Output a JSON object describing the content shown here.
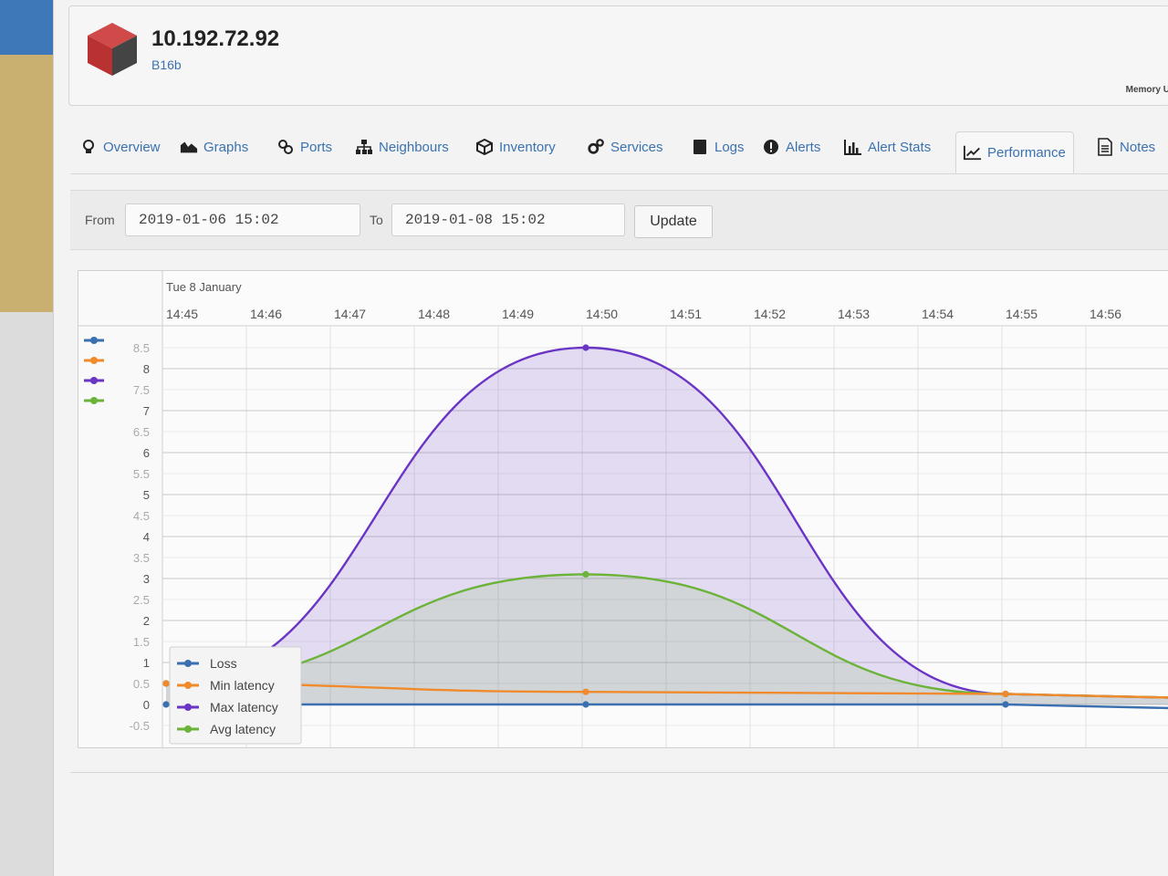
{
  "device": {
    "title": "10.192.72.92",
    "subtitle": "B16b",
    "memory_label": "Memory U"
  },
  "tabs": [
    {
      "label": "Overview",
      "icon": "lightbulb-icon"
    },
    {
      "label": "Graphs",
      "icon": "area-chart-icon"
    },
    {
      "label": "Ports",
      "icon": "link-icon"
    },
    {
      "label": "Neighbours",
      "icon": "sitemap-icon"
    },
    {
      "label": "Inventory",
      "icon": "cube-icon"
    },
    {
      "label": "Services",
      "icon": "cogs-icon"
    },
    {
      "label": "Logs",
      "icon": "book-icon"
    },
    {
      "label": "Alerts",
      "icon": "exclamation-circle-icon"
    },
    {
      "label": "Alert Stats",
      "icon": "bar-chart-icon"
    },
    {
      "label": "Performance",
      "icon": "line-chart-icon",
      "active": true
    },
    {
      "label": "Notes",
      "icon": "file-text-icon"
    }
  ],
  "filter": {
    "from_label": "From",
    "from_value": "2019-01-06 15:02",
    "to_label": "To",
    "to_value": "2019-01-08 15:02",
    "update_label": "Update"
  },
  "chart_data": {
    "type": "area",
    "date_label": "Tue 8 January",
    "x_ticks": [
      "14:45",
      "14:46",
      "14:47",
      "14:48",
      "14:49",
      "14:50",
      "14:51",
      "14:52",
      "14:53",
      "14:54",
      "14:55",
      "14:56"
    ],
    "y_ticks": [
      "8.5",
      "8",
      "7.5",
      "7",
      "6.5",
      "6",
      "5.5",
      "5",
      "4.5",
      "4",
      "3.5",
      "3",
      "2.5",
      "2",
      "1.5",
      "1",
      "0.5",
      "0",
      "-0.5"
    ],
    "ylim": [
      -0.5,
      8.5
    ],
    "grid": true,
    "legend_position": "bottom-left",
    "series": [
      {
        "name": "Loss",
        "color": "#3a6fb0",
        "x": [
          "14:45",
          "14:50",
          "14:55"
        ],
        "values": [
          0,
          0,
          0
        ]
      },
      {
        "name": "Min latency",
        "color": "#f08a2c",
        "x": [
          "14:45",
          "14:50",
          "14:55"
        ],
        "values": [
          0.5,
          0.3,
          0.25
        ]
      },
      {
        "name": "Max latency",
        "color": "#6a35c4",
        "x": [
          "14:45",
          "14:50",
          "14:55"
        ],
        "values": [
          0.5,
          8.5,
          0.25
        ]
      },
      {
        "name": "Avg latency",
        "color": "#6cb33a",
        "x": [
          "14:45",
          "14:50",
          "14:55"
        ],
        "values": [
          0.5,
          3.1,
          0.25
        ]
      }
    ]
  }
}
